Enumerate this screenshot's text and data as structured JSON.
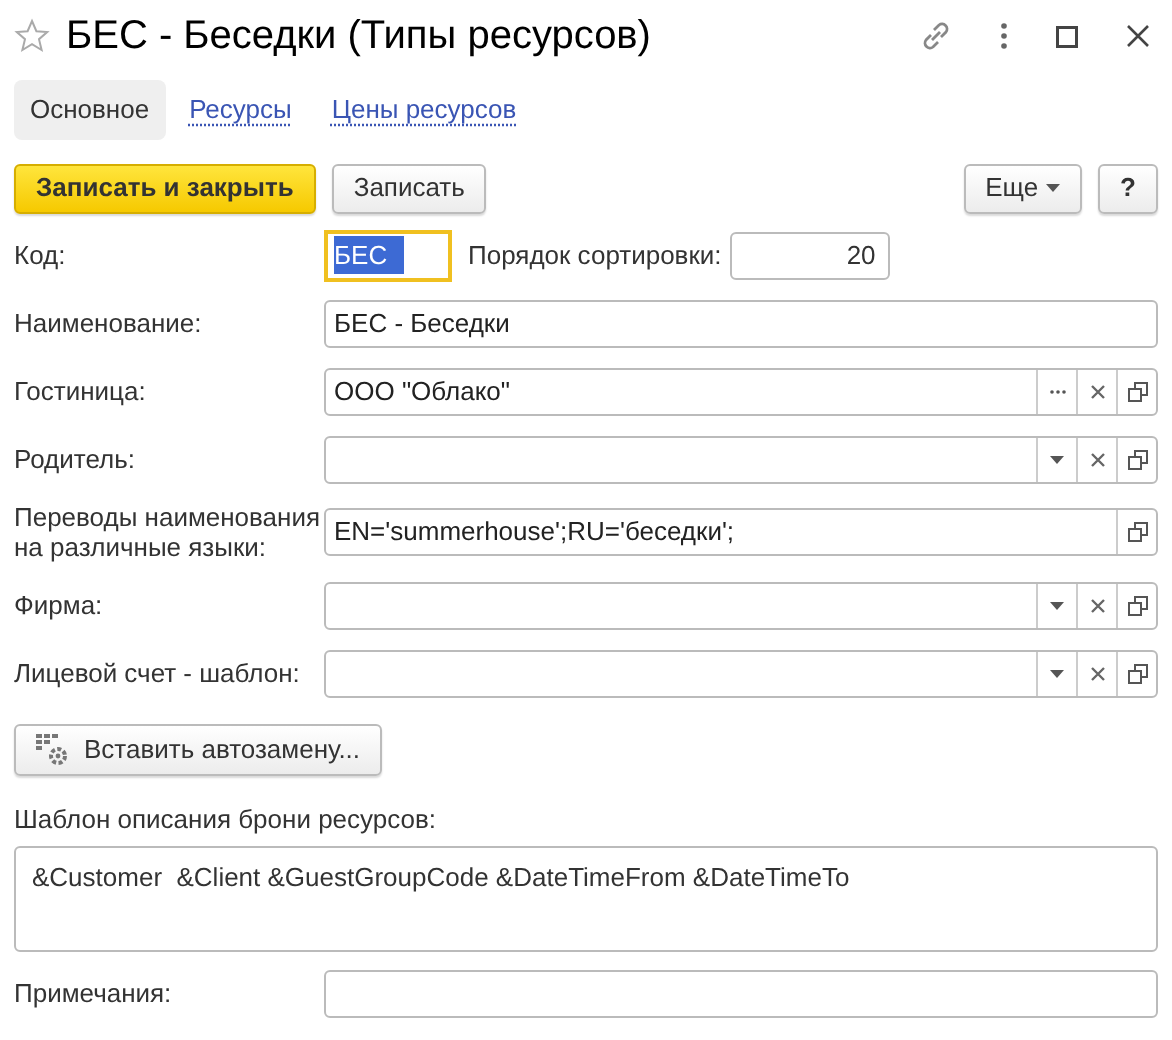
{
  "window": {
    "title": "БЕС - Беседки (Типы ресурсов)"
  },
  "tabs": [
    {
      "label": "Основное",
      "selected": true
    },
    {
      "label": "Ресурсы",
      "selected": false
    },
    {
      "label": "Цены ресурсов",
      "selected": false
    }
  ],
  "toolbar": {
    "buttons": [
      {
        "label": "Записать и закрыть",
        "kind": "primary"
      },
      {
        "label": "Записать",
        "kind": "default"
      }
    ],
    "more": {
      "label": "Еще"
    },
    "help": {
      "label": "?"
    }
  },
  "code": {
    "label": "Код:",
    "value": "БЕС",
    "focused": true,
    "text_selected": true
  },
  "sort_order": {
    "label": "Порядок сортировки:",
    "value": "20"
  },
  "fields": [
    {
      "label": "Наименование:",
      "value": "БЕС - Беседки"
    },
    {
      "label": "Гостиница:",
      "value": "ООО \"Облако\"",
      "buttons": [
        {
          "kind": "choose"
        },
        {
          "kind": "clear"
        },
        {
          "kind": "open"
        }
      ]
    },
    {
      "label": "Родитель:",
      "buttons": [
        {
          "kind": "dropdown"
        },
        {
          "kind": "clear"
        },
        {
          "kind": "open"
        }
      ]
    },
    {
      "label": "Переводы наименования на различные языки:",
      "value": "EN='summerhouse';RU='беседки';",
      "buttons": [
        {
          "kind": "open"
        }
      ]
    },
    {
      "label": "Фирма:",
      "buttons": [
        {
          "kind": "dropdown"
        },
        {
          "kind": "clear"
        },
        {
          "kind": "open"
        }
      ]
    },
    {
      "label": "Лицевой счет - шаблон:",
      "buttons": [
        {
          "kind": "dropdown"
        },
        {
          "kind": "clear"
        },
        {
          "kind": "open"
        }
      ]
    }
  ],
  "insert_button": {
    "label": "Вставить автозамену..."
  },
  "template": {
    "label": "Шаблон описания брони ресурсов:",
    "value": "&Customer  &Client &GuestGroupCode &DateTimeFrom &DateTimeTo"
  },
  "notes": {
    "label": "Примечания:"
  }
}
